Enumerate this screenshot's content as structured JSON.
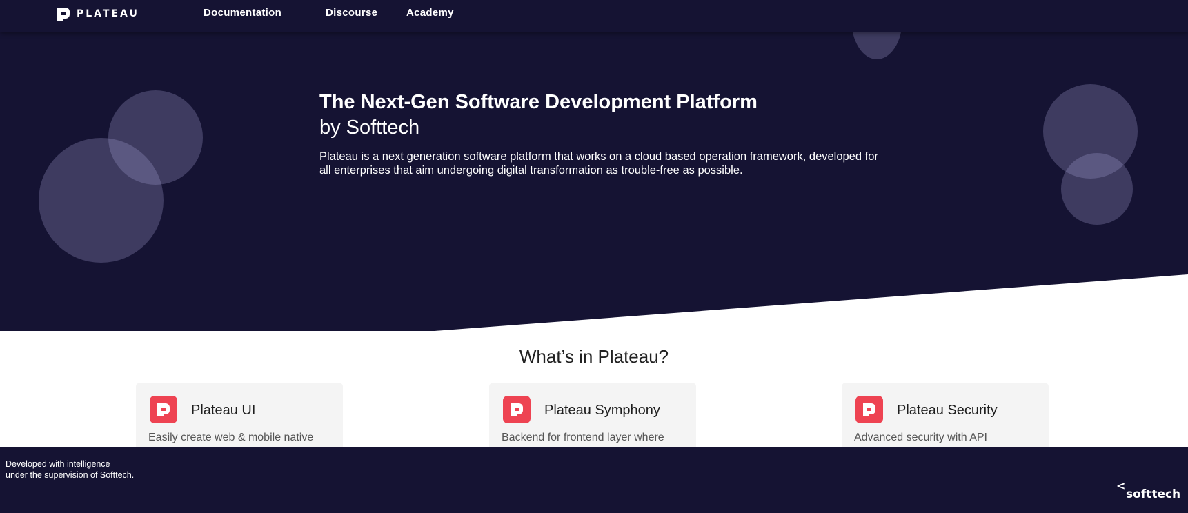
{
  "nav": {
    "brand": "PLATEAU",
    "links": [
      "Documentation",
      "Discourse",
      "Academy"
    ]
  },
  "hero": {
    "title": "The Next-Gen Software Development Platform",
    "subtitle": "by Softtech",
    "description": "Plateau is a next generation software platform that works on a cloud based operation framework, developed for all enterprises that aim undergoing digital transformation as trouble-free as possible."
  },
  "features": {
    "title": "What’s in Plateau?",
    "cards": [
      {
        "title": "Plateau UI",
        "description": "Easily create web & mobile native"
      },
      {
        "title": "Plateau Symphony",
        "description": "Backend for frontend layer where"
      },
      {
        "title": "Plateau Security",
        "description": "Advanced security with API"
      }
    ]
  },
  "footer": {
    "line1": "Developed with intelligence",
    "line2": "under the supervision of Softtech.",
    "brand_symbol": "<",
    "brand_name": "softtech"
  },
  "colors": {
    "navy": "#151333",
    "accent": "#ee4352",
    "card_bg": "#f4f4f4"
  },
  "icons": [
    "plateau-logo-icon",
    "plateau-card-icon"
  ]
}
